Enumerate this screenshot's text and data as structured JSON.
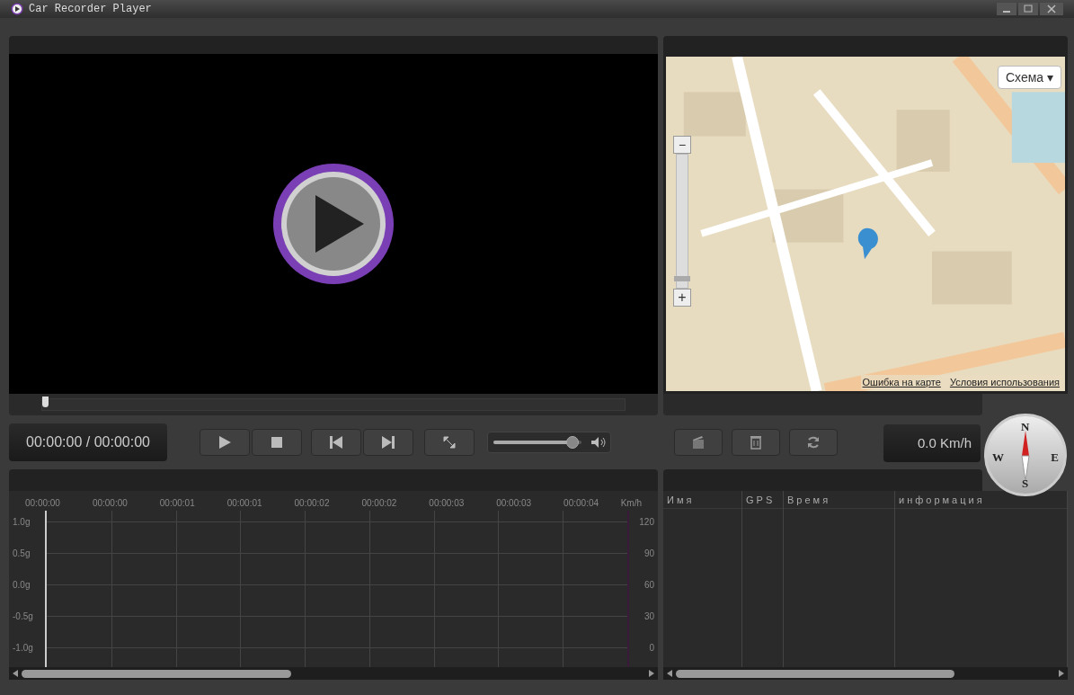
{
  "window": {
    "title": "Car Recorder Player"
  },
  "player": {
    "seek": {
      "level": 0.0
    },
    "time": "00:00:00 / 00:00:00",
    "volume": {
      "level": 0.9
    }
  },
  "map": {
    "kind": "picture",
    "layer_button": "Схема ▾",
    "zoom_in": "+",
    "zoom_out": "−",
    "zoom": {
      "level": 0.05
    },
    "links": [
      "Ошибка на карте",
      "Условия использования"
    ]
  },
  "speed": "0.0 Km/h",
  "compass": {
    "labels": [
      "N",
      "W",
      "E",
      "S"
    ]
  },
  "graph": {
    "time_labels": [
      "00:00:00",
      "00:00:00",
      "00:00:01",
      "00:00:01",
      "00:00:02",
      "00:00:02",
      "00:00:03",
      "00:00:03",
      "00:00:04"
    ],
    "right_unit": "Km/h",
    "left_labels": [
      "1.0g",
      "0.5g",
      "0.0g",
      "-0.5g",
      "-1.0g"
    ],
    "right_labels": [
      "120",
      "90",
      "60",
      "30",
      "0"
    ]
  },
  "file_table": {
    "columns": [
      "Имя",
      "GPS",
      "Время",
      "информация"
    ]
  }
}
